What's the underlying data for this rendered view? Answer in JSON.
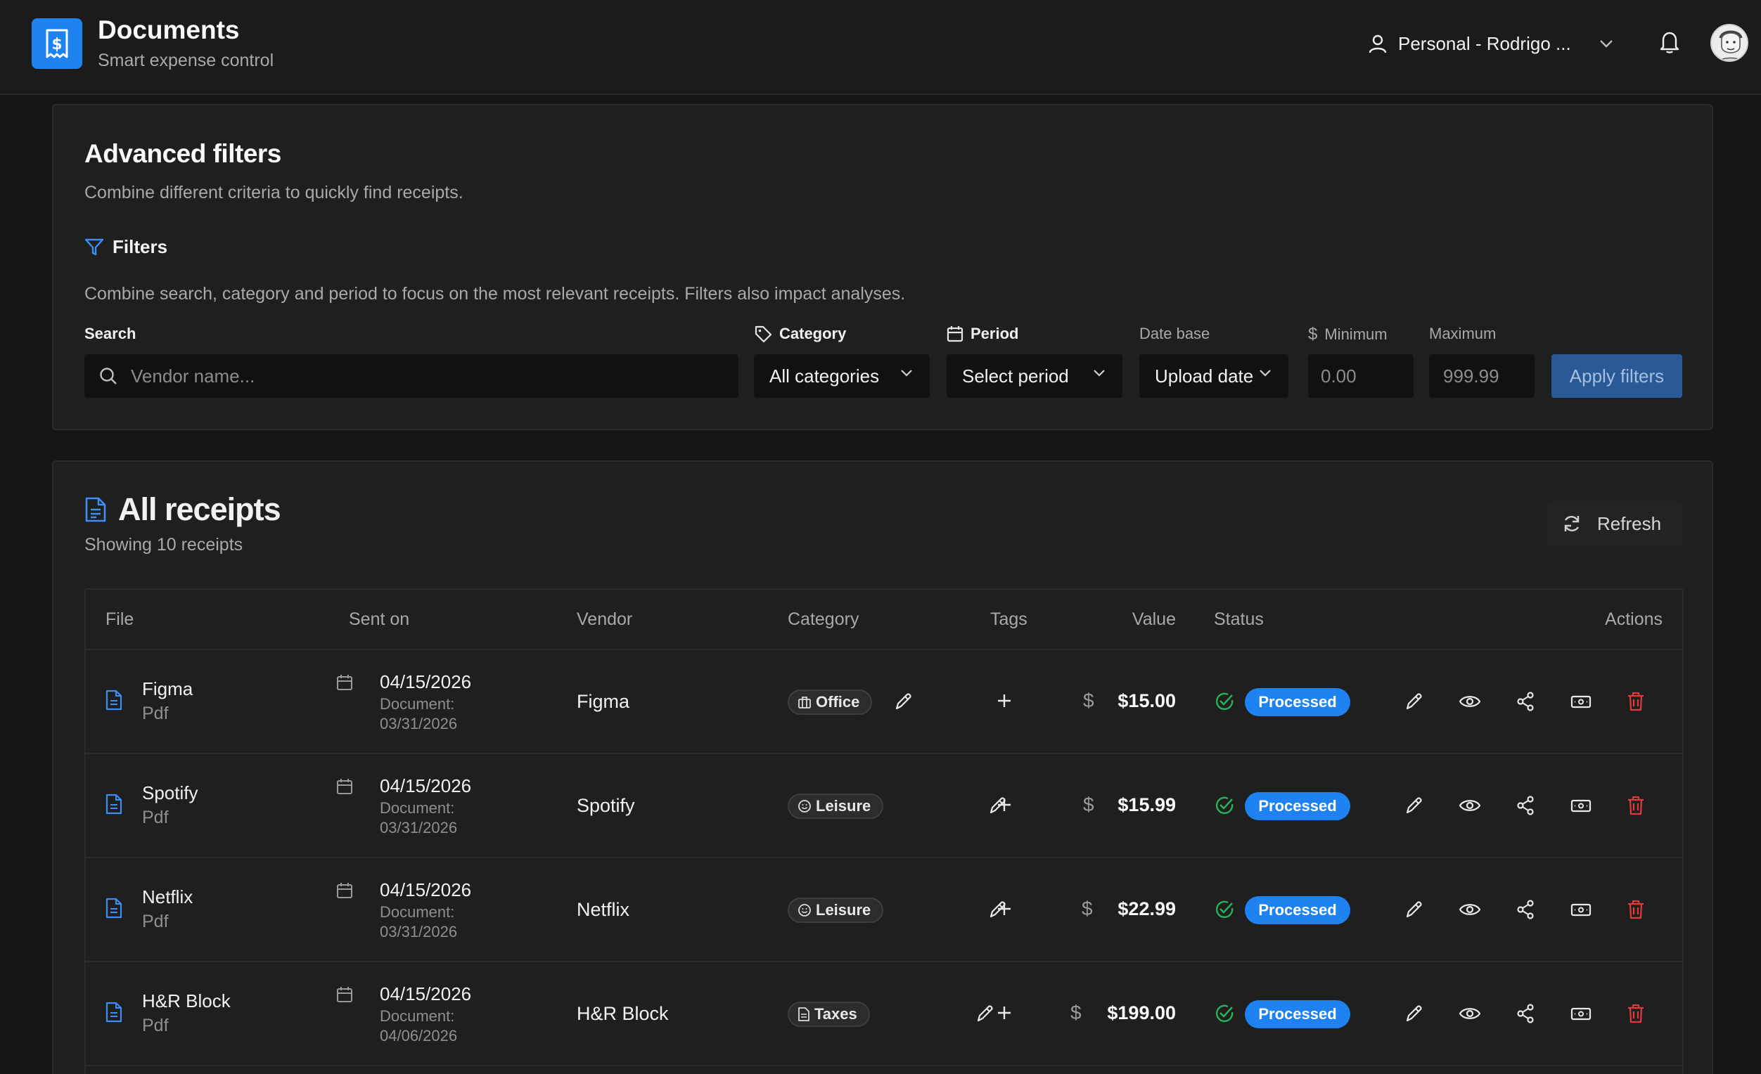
{
  "app": {
    "title": "Documents",
    "subtitle": "Smart expense control",
    "account_label": "Personal - Rodrigo ...",
    "logo_icon": "receipt-dollar-icon",
    "accent": "#1e83f0"
  },
  "filters": {
    "title": "Advanced filters",
    "description": "Combine different criteria to quickly find receipts.",
    "heading": "Filters",
    "note": "Combine search, category and period to focus on the most relevant receipts. Filters also impact analyses.",
    "search": {
      "label": "Search",
      "placeholder": "Vendor name..."
    },
    "category": {
      "label": "Category",
      "value": "All categories"
    },
    "period": {
      "label": "Period",
      "value": "Select period"
    },
    "date_base": {
      "label": "Date base",
      "value": "Upload date"
    },
    "minimum": {
      "label": "Minimum",
      "placeholder": "0.00"
    },
    "maximum": {
      "label": "Maximum",
      "placeholder": "999.99"
    },
    "apply_label": "Apply filters"
  },
  "receipts": {
    "title": "All receipts",
    "count_text": "Showing 10 receipts",
    "refresh_label": "Refresh",
    "columns": [
      "File",
      "Sent on",
      "Vendor",
      "Category",
      "Tags",
      "Value",
      "Status",
      "Actions"
    ],
    "rows": [
      {
        "file": "Figma",
        "type": "Pdf",
        "sent": "04/15/2026",
        "doc_label": "Document:",
        "doc_date": "03/31/2026",
        "vendor": "Figma",
        "category": "Office",
        "category_icon": "briefcase-icon",
        "currency": "$",
        "value": "$15.00",
        "status": "Processed"
      },
      {
        "file": "Spotify",
        "type": "Pdf",
        "sent": "04/15/2026",
        "doc_label": "Document:",
        "doc_date": "03/31/2026",
        "vendor": "Spotify",
        "category": "Leisure",
        "category_icon": "smile-icon",
        "currency": "$",
        "value": "$15.99",
        "status": "Processed"
      },
      {
        "file": "Netflix",
        "type": "Pdf",
        "sent": "04/15/2026",
        "doc_label": "Document:",
        "doc_date": "03/31/2026",
        "vendor": "Netflix",
        "category": "Leisure",
        "category_icon": "smile-icon",
        "currency": "$",
        "value": "$22.99",
        "status": "Processed"
      },
      {
        "file": "H&R Block",
        "type": "Pdf",
        "sent": "04/15/2026",
        "doc_label": "Document:",
        "doc_date": "04/06/2026",
        "vendor": "H&R Block",
        "category": "Taxes",
        "category_icon": "document-icon",
        "currency": "$",
        "value": "$199.00",
        "status": "Processed"
      }
    ]
  }
}
